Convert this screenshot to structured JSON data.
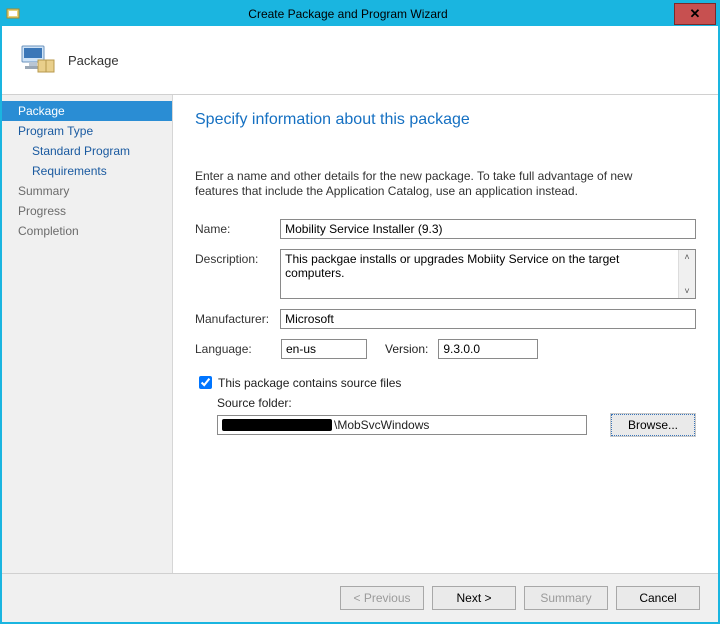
{
  "window": {
    "title": "Create Package and Program Wizard",
    "close_glyph": "✕"
  },
  "header": {
    "title": "Package"
  },
  "sidebar": {
    "items": [
      {
        "label": "Package",
        "selected": true
      },
      {
        "label": "Program Type"
      },
      {
        "label": "Standard Program",
        "child": true
      },
      {
        "label": "Requirements",
        "child": true
      },
      {
        "label": "Summary",
        "muted": true
      },
      {
        "label": "Progress",
        "muted": true
      },
      {
        "label": "Completion",
        "muted": true
      }
    ]
  },
  "content": {
    "heading": "Specify information about this package",
    "instructions": "Enter a name and other details for the new package. To take full advantage of new features that include the Application Catalog, use an application instead.",
    "labels": {
      "name": "Name:",
      "description": "Description:",
      "manufacturer": "Manufacturer:",
      "language": "Language:",
      "version": "Version:",
      "source_checkbox": "This package contains source files",
      "source_folder": "Source folder:",
      "browse": "Browse..."
    },
    "values": {
      "name": "Mobility Service Installer (9.3)",
      "description": "This packgae installs or upgrades Mobiity Service on the target computers.",
      "manufacturer": "Microsoft",
      "language": "en-us",
      "version": "9.3.0.0",
      "source_visible": "\\MobSvcWindows"
    },
    "source_checked": true
  },
  "footer": {
    "previous": "< Previous",
    "next": "Next >",
    "summary": "Summary",
    "cancel": "Cancel"
  }
}
